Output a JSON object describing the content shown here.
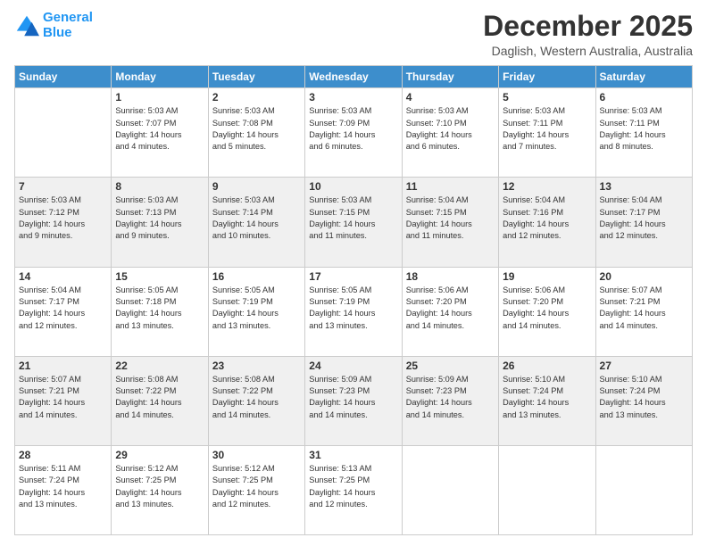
{
  "logo": {
    "line1": "General",
    "line2": "Blue"
  },
  "title": "December 2025",
  "location": "Daglish, Western Australia, Australia",
  "weekdays": [
    "Sunday",
    "Monday",
    "Tuesday",
    "Wednesday",
    "Thursday",
    "Friday",
    "Saturday"
  ],
  "weeks": [
    [
      {
        "day": "",
        "info": ""
      },
      {
        "day": "1",
        "info": "Sunrise: 5:03 AM\nSunset: 7:07 PM\nDaylight: 14 hours\nand 4 minutes."
      },
      {
        "day": "2",
        "info": "Sunrise: 5:03 AM\nSunset: 7:08 PM\nDaylight: 14 hours\nand 5 minutes."
      },
      {
        "day": "3",
        "info": "Sunrise: 5:03 AM\nSunset: 7:09 PM\nDaylight: 14 hours\nand 6 minutes."
      },
      {
        "day": "4",
        "info": "Sunrise: 5:03 AM\nSunset: 7:10 PM\nDaylight: 14 hours\nand 6 minutes."
      },
      {
        "day": "5",
        "info": "Sunrise: 5:03 AM\nSunset: 7:11 PM\nDaylight: 14 hours\nand 7 minutes."
      },
      {
        "day": "6",
        "info": "Sunrise: 5:03 AM\nSunset: 7:11 PM\nDaylight: 14 hours\nand 8 minutes."
      }
    ],
    [
      {
        "day": "7",
        "info": "Sunrise: 5:03 AM\nSunset: 7:12 PM\nDaylight: 14 hours\nand 9 minutes."
      },
      {
        "day": "8",
        "info": "Sunrise: 5:03 AM\nSunset: 7:13 PM\nDaylight: 14 hours\nand 9 minutes."
      },
      {
        "day": "9",
        "info": "Sunrise: 5:03 AM\nSunset: 7:14 PM\nDaylight: 14 hours\nand 10 minutes."
      },
      {
        "day": "10",
        "info": "Sunrise: 5:03 AM\nSunset: 7:15 PM\nDaylight: 14 hours\nand 11 minutes."
      },
      {
        "day": "11",
        "info": "Sunrise: 5:04 AM\nSunset: 7:15 PM\nDaylight: 14 hours\nand 11 minutes."
      },
      {
        "day": "12",
        "info": "Sunrise: 5:04 AM\nSunset: 7:16 PM\nDaylight: 14 hours\nand 12 minutes."
      },
      {
        "day": "13",
        "info": "Sunrise: 5:04 AM\nSunset: 7:17 PM\nDaylight: 14 hours\nand 12 minutes."
      }
    ],
    [
      {
        "day": "14",
        "info": "Sunrise: 5:04 AM\nSunset: 7:17 PM\nDaylight: 14 hours\nand 12 minutes."
      },
      {
        "day": "15",
        "info": "Sunrise: 5:05 AM\nSunset: 7:18 PM\nDaylight: 14 hours\nand 13 minutes."
      },
      {
        "day": "16",
        "info": "Sunrise: 5:05 AM\nSunset: 7:19 PM\nDaylight: 14 hours\nand 13 minutes."
      },
      {
        "day": "17",
        "info": "Sunrise: 5:05 AM\nSunset: 7:19 PM\nDaylight: 14 hours\nand 13 minutes."
      },
      {
        "day": "18",
        "info": "Sunrise: 5:06 AM\nSunset: 7:20 PM\nDaylight: 14 hours\nand 14 minutes."
      },
      {
        "day": "19",
        "info": "Sunrise: 5:06 AM\nSunset: 7:20 PM\nDaylight: 14 hours\nand 14 minutes."
      },
      {
        "day": "20",
        "info": "Sunrise: 5:07 AM\nSunset: 7:21 PM\nDaylight: 14 hours\nand 14 minutes."
      }
    ],
    [
      {
        "day": "21",
        "info": "Sunrise: 5:07 AM\nSunset: 7:21 PM\nDaylight: 14 hours\nand 14 minutes."
      },
      {
        "day": "22",
        "info": "Sunrise: 5:08 AM\nSunset: 7:22 PM\nDaylight: 14 hours\nand 14 minutes."
      },
      {
        "day": "23",
        "info": "Sunrise: 5:08 AM\nSunset: 7:22 PM\nDaylight: 14 hours\nand 14 minutes."
      },
      {
        "day": "24",
        "info": "Sunrise: 5:09 AM\nSunset: 7:23 PM\nDaylight: 14 hours\nand 14 minutes."
      },
      {
        "day": "25",
        "info": "Sunrise: 5:09 AM\nSunset: 7:23 PM\nDaylight: 14 hours\nand 14 minutes."
      },
      {
        "day": "26",
        "info": "Sunrise: 5:10 AM\nSunset: 7:24 PM\nDaylight: 14 hours\nand 13 minutes."
      },
      {
        "day": "27",
        "info": "Sunrise: 5:10 AM\nSunset: 7:24 PM\nDaylight: 14 hours\nand 13 minutes."
      }
    ],
    [
      {
        "day": "28",
        "info": "Sunrise: 5:11 AM\nSunset: 7:24 PM\nDaylight: 14 hours\nand 13 minutes."
      },
      {
        "day": "29",
        "info": "Sunrise: 5:12 AM\nSunset: 7:25 PM\nDaylight: 14 hours\nand 13 minutes."
      },
      {
        "day": "30",
        "info": "Sunrise: 5:12 AM\nSunset: 7:25 PM\nDaylight: 14 hours\nand 12 minutes."
      },
      {
        "day": "31",
        "info": "Sunrise: 5:13 AM\nSunset: 7:25 PM\nDaylight: 14 hours\nand 12 minutes."
      },
      {
        "day": "",
        "info": ""
      },
      {
        "day": "",
        "info": ""
      },
      {
        "day": "",
        "info": ""
      }
    ]
  ]
}
